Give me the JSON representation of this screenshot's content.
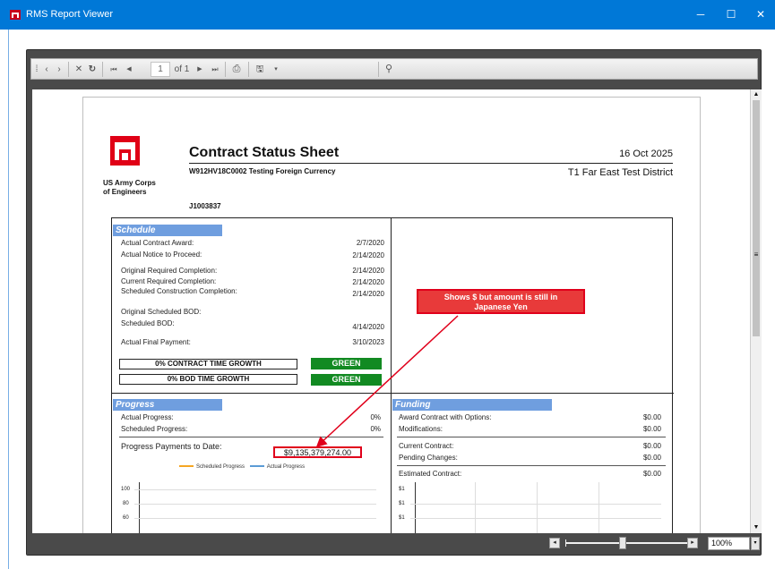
{
  "window": {
    "title": "RMS Report Viewer",
    "minimize": "─",
    "maximize": "☐",
    "close": "✕"
  },
  "toolbar": {
    "page_current": "1",
    "page_of": "of 1"
  },
  "report": {
    "title": "Contract Status Sheet",
    "date": "16 Oct 2025",
    "contract": "W912HV18C0002  Testing Foreign Currency",
    "district": "T1 Far East Test District",
    "job": "J1003837",
    "org_line1": "US Army Corps",
    "org_line2": "of Engineers",
    "schedule": {
      "header": "Schedule",
      "rows": [
        {
          "label": "Actual Contract Award:",
          "value": "2/7/2020"
        },
        {
          "label": "Actual Notice to Proceed:",
          "value": "2/14/2020"
        },
        {
          "label": "Original Required Completion:",
          "value": "2/14/2020"
        },
        {
          "label": "Current Required Completion:",
          "value": "2/14/2020"
        },
        {
          "label": "Scheduled Construction Completion:",
          "value": "2/14/2020"
        },
        {
          "label": "Original Scheduled BOD:",
          "value": ""
        },
        {
          "label": "Scheduled BOD:",
          "value": "4/14/2020"
        },
        {
          "label": "Actual Final Payment:",
          "value": "3/10/2023"
        }
      ],
      "contract_growth": "0% CONTRACT TIME GROWTH",
      "bod_growth": "0% BOD TIME GROWTH",
      "status1": "GREEN",
      "status2": "GREEN"
    },
    "progress": {
      "header": "Progress",
      "actual_label": "Actual Progress:",
      "actual_value": "0%",
      "scheduled_label": "Scheduled Progress:",
      "scheduled_value": "0%",
      "payments_label": "Progress Payments to Date:",
      "payments_value": "$9,135,379,274.00",
      "legend_scheduled": "Scheduled Progress",
      "legend_actual": "Actual Progress",
      "y_ticks": [
        "100",
        "80",
        "60"
      ]
    },
    "funding": {
      "header": "Funding",
      "rows": [
        {
          "label": "Award Contract with Options:",
          "value": "$0.00"
        },
        {
          "label": "Modifications:",
          "value": "$0.00"
        },
        {
          "label": "Current Contract:",
          "value": "$0.00"
        },
        {
          "label": "Pending Changes:",
          "value": "$0.00"
        },
        {
          "label": "Estimated Contract:",
          "value": "$0.00"
        }
      ],
      "y_ticks": [
        "$1",
        "$1",
        "$1"
      ]
    },
    "callout_line1": "Shows $ but amount is still in",
    "callout_line2": "Japanese Yen"
  },
  "status": {
    "zoom": "100%"
  },
  "colors": {
    "titlebar": "#0078d7",
    "accent_red": "#e0001b",
    "green": "#128a22",
    "section_blue": "#6f9edf"
  }
}
